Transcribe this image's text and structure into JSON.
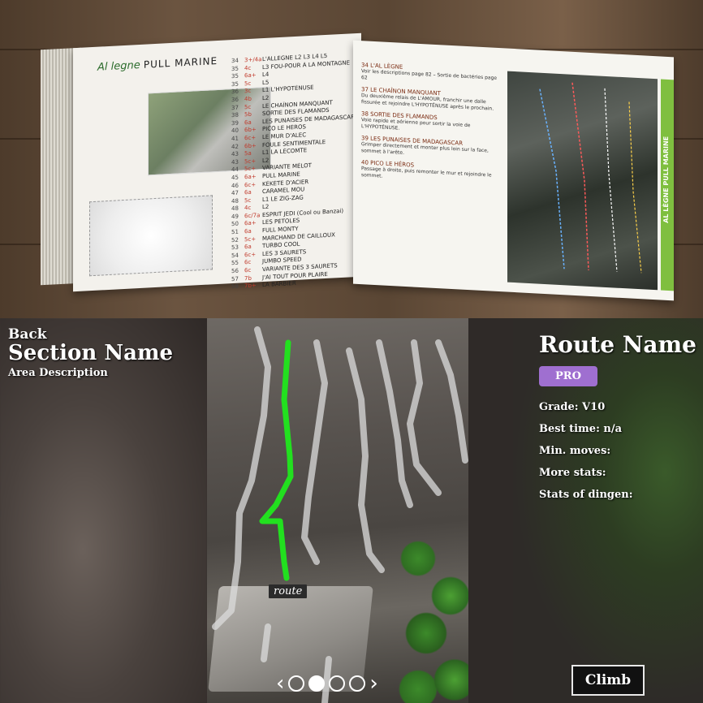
{
  "photo": {
    "left_page": {
      "title_script": "Al legne",
      "title": "PULL MARINE",
      "routes": [
        {
          "n": "34",
          "g": "3+/4a",
          "name": "L'ALLÈGNE L2 L3 L4 L5"
        },
        {
          "n": "35",
          "g": "4c",
          "name": "L3 FOU-POUR À LA MONTAGNE"
        },
        {
          "n": "35",
          "g": "6a+",
          "name": "L4"
        },
        {
          "n": "35",
          "g": "5c",
          "name": "L5"
        },
        {
          "n": "36",
          "g": "3c",
          "name": "L1 L'HYPOTÉNUSE"
        },
        {
          "n": "36",
          "g": "4b",
          "name": "L2"
        },
        {
          "n": "37",
          "g": "5c",
          "name": "LE CHAÎNON MANQUANT"
        },
        {
          "n": "38",
          "g": "5b",
          "name": "SORTIE DES FLAMANDS"
        },
        {
          "n": "39",
          "g": "6a",
          "name": "LES PUNAISES DE MADAGASCAR"
        },
        {
          "n": "40",
          "g": "6b+",
          "name": "PICO LE HÉROS"
        },
        {
          "n": "41",
          "g": "6c+",
          "name": "LE MUR D'ALEC"
        },
        {
          "n": "42",
          "g": "6b+",
          "name": "FOULE SENTIMENTALE"
        },
        {
          "n": "43",
          "g": "5a",
          "name": "L1 LA LÉCOMTE"
        },
        {
          "n": "43",
          "g": "5c+",
          "name": "L2"
        },
        {
          "n": "44",
          "g": "5c+",
          "name": "VARIANTE MÉLOT"
        },
        {
          "n": "45",
          "g": "6a+",
          "name": "PULL MARINE"
        },
        {
          "n": "46",
          "g": "6c+",
          "name": "KÉKÉTE D'ACIER"
        },
        {
          "n": "47",
          "g": "6a",
          "name": "CARAMEL MOU"
        },
        {
          "n": "48",
          "g": "5c",
          "name": "L1 LE ZIG-ZAG"
        },
        {
          "n": "48",
          "g": "4c",
          "name": "L2"
        },
        {
          "n": "49",
          "g": "6c/7a",
          "name": "ESPRIT JEDI (Cool ou Banzai)"
        },
        {
          "n": "50",
          "g": "6a+",
          "name": "LES PÉTOLES"
        },
        {
          "n": "51",
          "g": "6a",
          "name": "FULL MONTY"
        },
        {
          "n": "52",
          "g": "5c+",
          "name": "MARCHAND DE CAILLOUX"
        },
        {
          "n": "53",
          "g": "6a",
          "name": "TURBO COOL"
        },
        {
          "n": "54",
          "g": "6c+",
          "name": "LES 3 SAURETS"
        },
        {
          "n": "55",
          "g": "6c",
          "name": "JUMBO SPEED"
        },
        {
          "n": "56",
          "g": "6c",
          "name": "VARIANTE DES 3 SAURETS"
        },
        {
          "n": "57",
          "g": "7b",
          "name": "J'AI TOUT POUR PLAIRE"
        },
        {
          "n": "58",
          "g": "7b+",
          "name": "LA BARBIER"
        }
      ]
    },
    "right_page": {
      "entries": [
        {
          "title": "34 L'AL LÈGNE",
          "text": "Voir les descriptions page 82 – Sortie de bactéries page 62"
        },
        {
          "title": "37 LE CHAÎNON MANQUANT",
          "text": "Du deuxième relais de L'AMOUR, franchir une dalle fissurée et rejoindre L'HYPOTÉNUSE après le prochain."
        },
        {
          "title": "38 SORTIE DES FLAMANDS",
          "text": "Voie rapide et aérienne pour sortir la voie de L'HYPOTÉNUSE."
        },
        {
          "title": "39 LES PUNAISES DE MADAGASCAR",
          "text": "Grimper directement et monter plus loin sur la face, sommet à l'arête."
        },
        {
          "title": "40 PICO LE HÉROS",
          "text": "Passage à droite, puis remonter le mur et rejoindre le sommet."
        }
      ],
      "side_band": "AL LÈGNE PULL MARINE"
    }
  },
  "app": {
    "back_label": "Back",
    "section_name": "Section Name",
    "area_description": "Area Description",
    "route_label": "route",
    "route_name": "Route Name",
    "badge": "PRO",
    "stats": {
      "grade": "Grade: V10",
      "best_time": "Best time: n/a",
      "min_moves": "Min. moves:",
      "more_stats": "More stats:",
      "stats_of_dingen": "Stats of dingen:"
    },
    "climb_label": "Climb",
    "pager": {
      "pages": 4,
      "active_index": 1
    },
    "colors": {
      "route_line": "#22e01f",
      "other_lines": "#d9d9d9",
      "badge": "#9f6fd0"
    }
  }
}
